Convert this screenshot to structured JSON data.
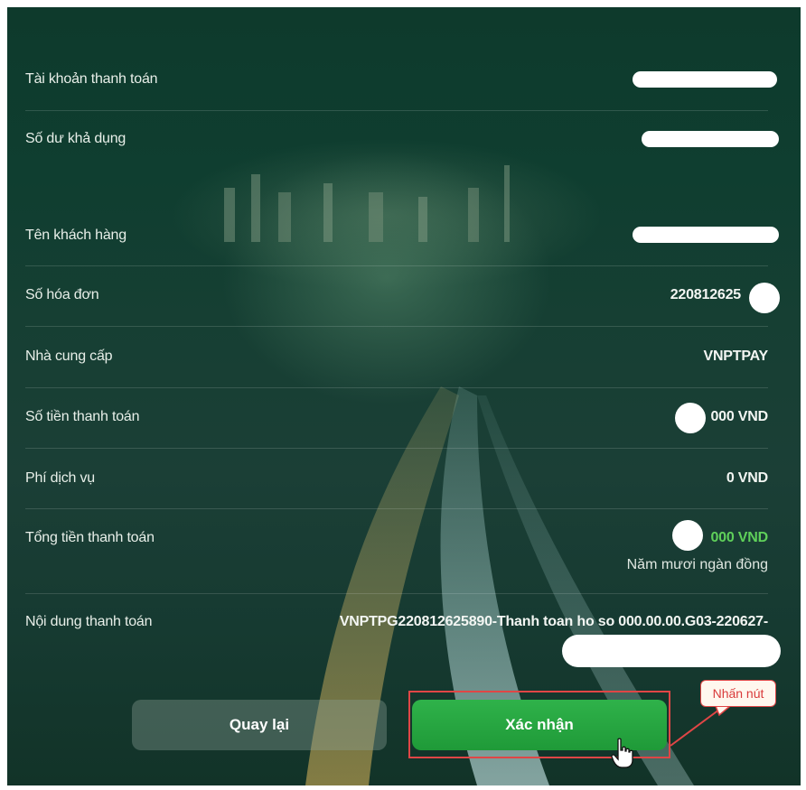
{
  "rows": {
    "account": {
      "label": "Tài khoản thanh toán"
    },
    "balance": {
      "label": "Số dư khả dụng"
    },
    "customer": {
      "label": "Tên khách hàng"
    },
    "invoice": {
      "label": "Số hóa đơn",
      "value": "220812625"
    },
    "provider": {
      "label": "Nhà cung cấp",
      "value": "VNPTPAY"
    },
    "amount": {
      "label": "Số tiền thanh toán",
      "value": "000 VND"
    },
    "fee": {
      "label": "Phí dịch vụ",
      "value": "0 VND"
    },
    "total": {
      "label": "Tổng tiền thanh toán",
      "value": "000 VND",
      "in_words": "Năm mươi ngàn đồng"
    },
    "content": {
      "label": "Nội dung thanh toán",
      "value": "VNPTPG220812625890-Thanh toan ho so 000.00.00.G03-220627-"
    }
  },
  "buttons": {
    "back_label": "Quay lại",
    "confirm_label": "Xác nhận"
  },
  "annotation": {
    "callout_text": "Nhấn nút"
  },
  "colors": {
    "accent_green": "#1f9a38",
    "total_green": "#5fd05a",
    "highlight_red": "#e04646"
  },
  "icons": {
    "cursor": "hand-pointer-icon"
  }
}
